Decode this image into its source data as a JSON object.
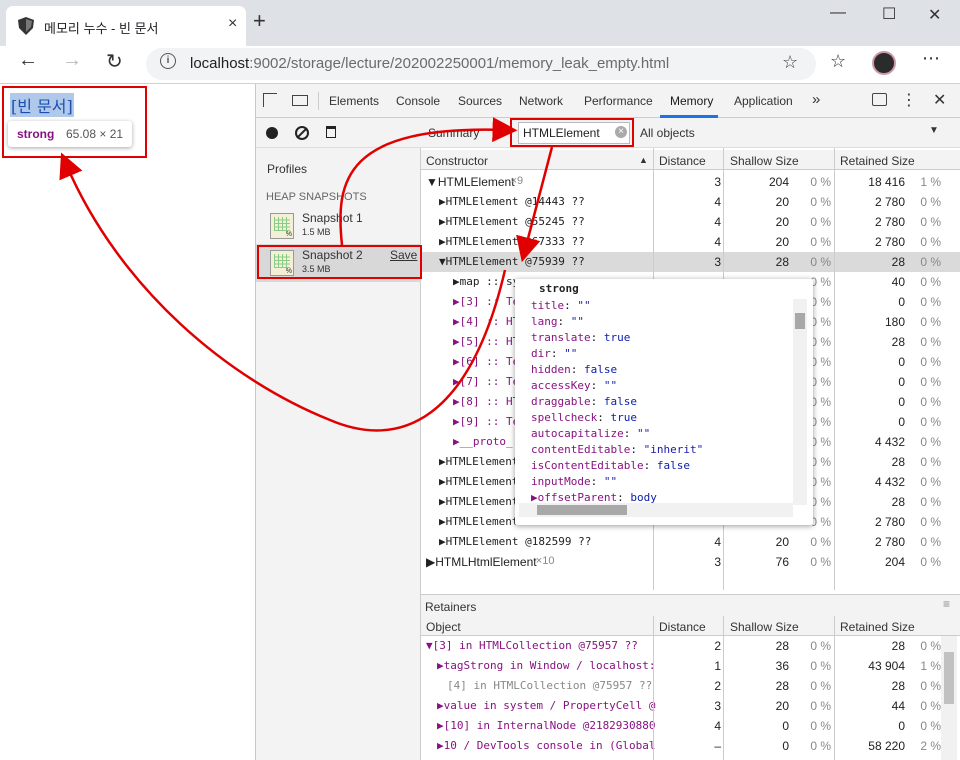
{
  "window": {
    "tab_title": "메모리 누수 - 빈 문서",
    "new_tab": "+",
    "tab_close": "×",
    "minimize": "—",
    "maximize": "☐",
    "close": "✕"
  },
  "address": {
    "host": "localhost",
    "rest": ":9002/storage/lecture/202002250001/memory_leak_empty.html"
  },
  "page": {
    "text": "[빈 문서]",
    "tooltip_tag": "strong",
    "tooltip_dim": "65.08 × 21"
  },
  "devtools": {
    "tabs": [
      "Elements",
      "Console",
      "Sources",
      "Network",
      "Performance",
      "Memory",
      "Application"
    ],
    "more": "»",
    "toolbar": {
      "summary": "Summary",
      "filter_value": "HTMLElement",
      "objects": "All objects"
    },
    "profiles": {
      "title": "Profiles",
      "section": "HEAP SNAPSHOTS",
      "snapshots": [
        {
          "name": "Snapshot 1",
          "size": "1.5 MB"
        },
        {
          "name": "Snapshot 2",
          "size": "3.5 MB",
          "save": "Save"
        }
      ]
    },
    "main_table": {
      "headers": [
        "Constructor",
        "Distance",
        "Shallow Size",
        "Retained Size"
      ],
      "rows": [
        {
          "name": "▼HTMLElement",
          "count": "×9",
          "dist": "3",
          "sh": "204",
          "shp": "0 %",
          "ret": "18 416",
          "retp": "1 %"
        },
        {
          "name": "▶HTMLElement @14443 ??",
          "dist": "4",
          "sh": "20",
          "shp": "0 %",
          "ret": "2 780",
          "retp": "0 %"
        },
        {
          "name": "▶HTMLElement @55245 ??",
          "dist": "4",
          "sh": "20",
          "shp": "0 %",
          "ret": "2 780",
          "retp": "0 %"
        },
        {
          "name": "▶HTMLElement @67333 ??",
          "dist": "4",
          "sh": "20",
          "shp": "0 %",
          "ret": "2 780",
          "retp": "0 %"
        },
        {
          "name": "▼HTMLElement @75939 ??",
          "dist": "3",
          "sh": "28",
          "shp": "0 %",
          "ret": "28",
          "retp": "0 %"
        },
        {
          "name": "▶map :: sy",
          "shp": "0 %",
          "ret": "40",
          "retp": "0 %"
        },
        {
          "name": "▶[3] :: Te",
          "shp": "0 %",
          "ret": "0",
          "retp": "0 %"
        },
        {
          "name": "▶[4] :: HT",
          "shp": "0 %",
          "ret": "180",
          "retp": "0 %"
        },
        {
          "name": "▶[5] :: HT",
          "shp": "0 %",
          "ret": "28",
          "retp": "0 %"
        },
        {
          "name": "▶[6] :: Te",
          "shp": "0 %",
          "ret": "0",
          "retp": "0 %"
        },
        {
          "name": "▶[7] :: Te",
          "shp": "0 %",
          "ret": "0",
          "retp": "0 %"
        },
        {
          "name": "▶[8] :: HT",
          "shp": "0 %",
          "ret": "0",
          "retp": "0 %"
        },
        {
          "name": "▶[9] :: Te",
          "shp": "0 %",
          "ret": "0",
          "retp": "0 %"
        },
        {
          "name": "▶__proto_",
          "shp": "0 %",
          "ret": "4 432",
          "retp": "0 %"
        },
        {
          "name": "▶HTMLElement",
          "shp": "0 %",
          "ret": "28",
          "retp": "0 %"
        },
        {
          "name": "▶HTMLElement",
          "shp": "0 %",
          "ret": "4 432",
          "retp": "0 %"
        },
        {
          "name": "▶HTMLElement",
          "shp": "0 %",
          "ret": "28",
          "retp": "0 %"
        },
        {
          "name": "▶HTMLElement",
          "shp": "0 %",
          "ret": "2 780",
          "retp": "0 %"
        },
        {
          "name": "▶HTMLElement @182599 ??",
          "dist": "4",
          "sh": "20",
          "shp": "0 %",
          "ret": "2 780",
          "retp": "0 %"
        },
        {
          "name": "▶HTMLHtmlElement",
          "count": "×10",
          "dist": "3",
          "sh": "76",
          "shp": "0 %",
          "ret": "204",
          "retp": "0 %"
        }
      ]
    },
    "retainers": {
      "title": "Retainers",
      "headers": [
        "Object",
        "Distance",
        "Shallow Size",
        "Retained Size"
      ],
      "rows": [
        {
          "name": "▼[3] in HTMLCollection @75957 ??",
          "dist": "2",
          "sh": "28",
          "shp": "0 %",
          "ret": "28",
          "retp": "0 %"
        },
        {
          "name": "▶tagStrong in Window / localhost:",
          "dist": "1",
          "sh": "36",
          "shp": "0 %",
          "ret": "43 904",
          "retp": "1 %"
        },
        {
          "name": "[4] in HTMLCollection @75957 ??",
          "dist": "2",
          "sh": "28",
          "shp": "0 %",
          "ret": "28",
          "retp": "0 %"
        },
        {
          "name": "▶value in system / PropertyCell @",
          "dist": "3",
          "sh": "20",
          "shp": "0 %",
          "ret": "44",
          "retp": "0 %"
        },
        {
          "name": "▶[10] in InternalNode @2182930880",
          "dist": "4",
          "sh": "0",
          "shp": "0 %",
          "ret": "0",
          "retp": "0 %"
        },
        {
          "name": "▶10 / DevTools console in (Global",
          "dist": "–",
          "sh": "0",
          "shp": "0 %",
          "ret": "58 220",
          "retp": "2 %"
        }
      ]
    },
    "popover": {
      "title": "strong",
      "props": [
        {
          "k": "title",
          "v": "\"\""
        },
        {
          "k": "lang",
          "v": "\"\""
        },
        {
          "k": "translate",
          "v": "true"
        },
        {
          "k": "dir",
          "v": "\"\""
        },
        {
          "k": "hidden",
          "v": "false"
        },
        {
          "k": "accessKey",
          "v": "\"\""
        },
        {
          "k": "draggable",
          "v": "false"
        },
        {
          "k": "spellcheck",
          "v": "true"
        },
        {
          "k": "autocapitalize",
          "v": "\"\""
        },
        {
          "k": "contentEditable",
          "v": "\"inherit\""
        },
        {
          "k": "isContentEditable",
          "v": "false"
        },
        {
          "k": "inputMode",
          "v": "\"\""
        },
        {
          "k": "▶offsetParent",
          "v": "body"
        }
      ]
    }
  }
}
